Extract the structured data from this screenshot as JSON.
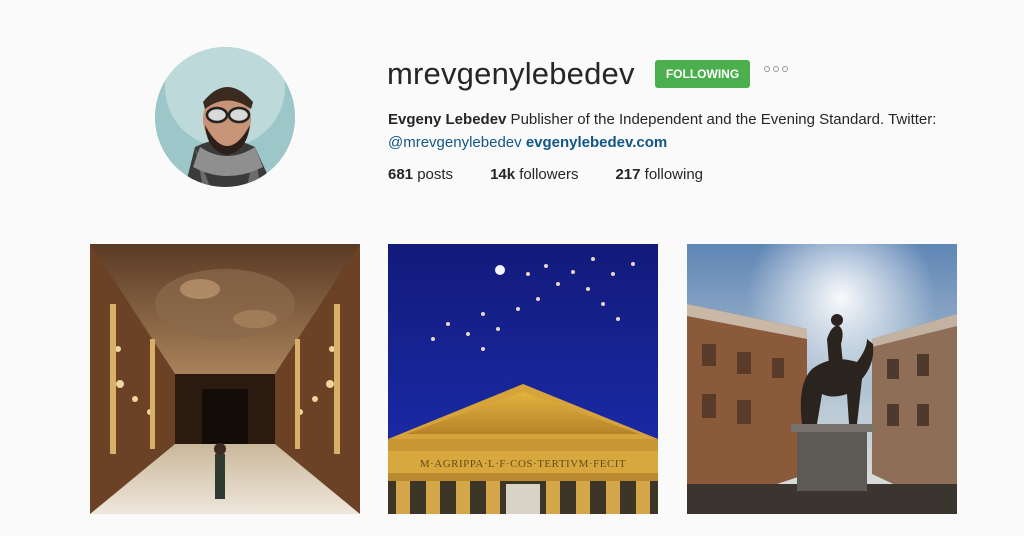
{
  "profile": {
    "username": "mrevgenylebedev",
    "follow_button": "FOLLOWING",
    "bio": {
      "full_name": "Evgeny Lebedev",
      "text": " Publisher of the Independent and the Evening Standard. Twitter: ",
      "mention": "@mrevgenylebedev",
      "website": "evgenylebedev.com"
    },
    "stats": {
      "posts_count": "681",
      "posts_label": " posts",
      "followers_count": "14k",
      "followers_label": " followers",
      "following_count": "217",
      "following_label": " following"
    }
  },
  "posts": [
    {
      "subject": "ornate baroque gallery hall"
    },
    {
      "subject": "pantheon facade at night",
      "inscription": "M·AGRIPPA·L·F·COS·TERTIVM·FECIT"
    },
    {
      "subject": "equestrian statue in piazza"
    }
  ],
  "colors": {
    "follow_green": "#4aaf4c",
    "link_blue": "#125688",
    "background": "#fafafa"
  }
}
